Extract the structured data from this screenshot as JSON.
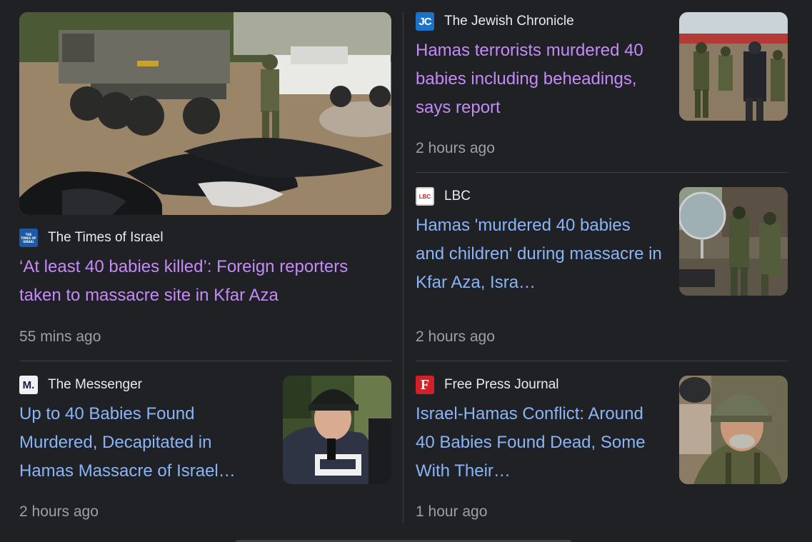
{
  "stories": [
    {
      "source": "The Times of Israel",
      "logo_text": "THE TIMES OF ISRAEL",
      "headline": "‘At least 40 babies killed’: Foreign reporters taken to massacre site in Kfar Aza",
      "time": "55 mins ago",
      "visited": true,
      "image": "military-truck-body-bags-photo"
    },
    {
      "source": "The Jewish Chronicle",
      "logo_text": "JC",
      "headline": "Hamas terrorists murdered 40 babies including beheadings, says report",
      "time": "2 hours ago",
      "visited": true,
      "image": "soldiers-at-site-photo"
    },
    {
      "source": "LBC",
      "logo_text": "LBC",
      "headline": "Hamas 'murdered 40 babies and children' during massacre in Kfar Aza, Isra…",
      "time": "2 hours ago",
      "visited": false,
      "image": "soldiers-with-mirror-photo"
    },
    {
      "source": "The Messenger",
      "logo_text": "M.",
      "headline": "Up to 40 Babies Found Murdered, Decapitated in Hamas Massacre of Israel…",
      "time": "2 hours ago",
      "visited": false,
      "image": "reporter-in-helmet-photo"
    },
    {
      "source": "Free Press Journal",
      "logo_text": "F",
      "headline": "Israel-Hamas Conflict: Around 40 Babies Found Dead, Some With Their…",
      "time": "1 hour ago",
      "visited": false,
      "image": "soldier-in-helmet-photo"
    }
  ],
  "colors": {
    "background": "#202124",
    "visited_link": "#c58af9",
    "link": "#8ab4f8",
    "source_text": "#e8eaed",
    "time_text": "#9aa0a6",
    "separator": "#3c4043"
  }
}
